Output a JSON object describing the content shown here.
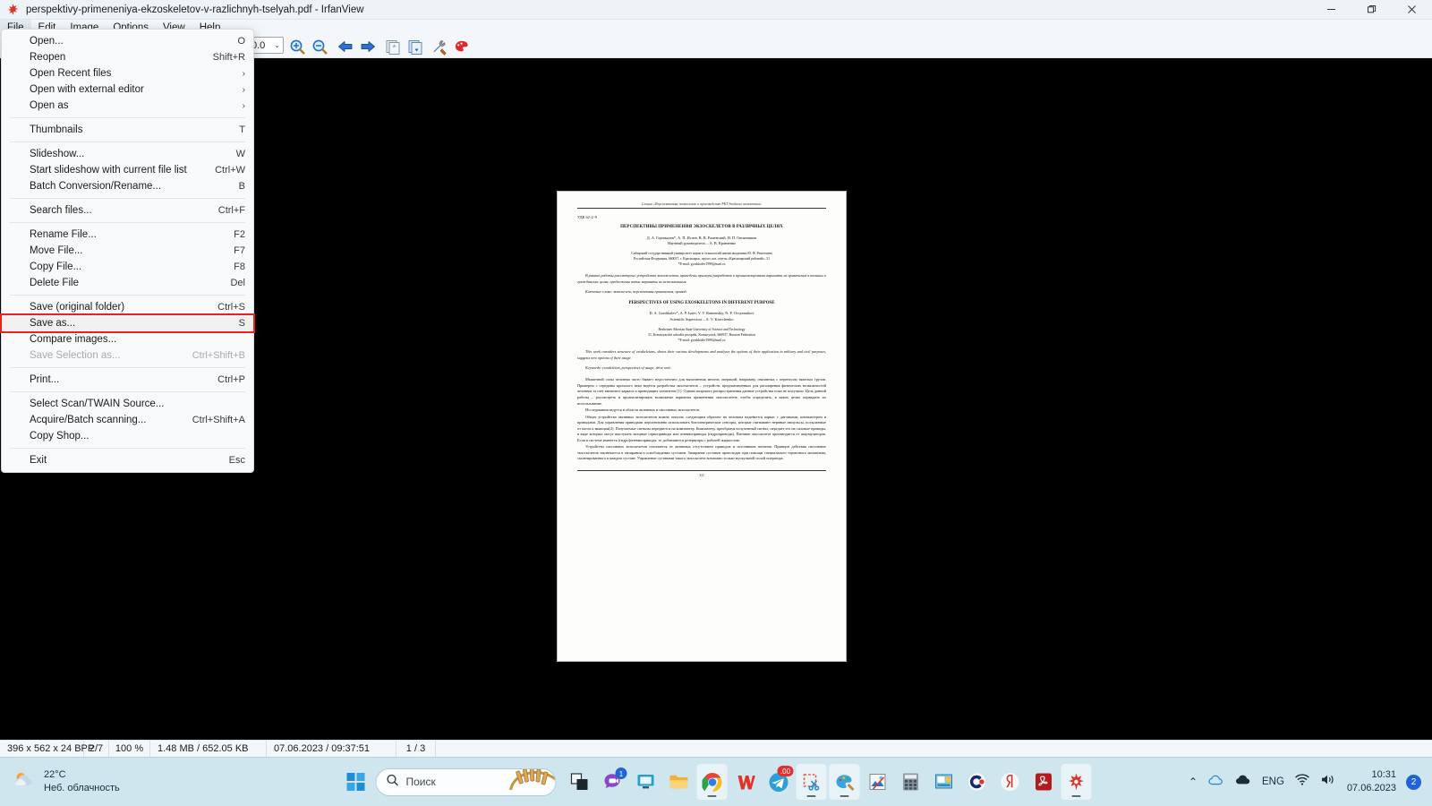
{
  "window": {
    "title": "perspektivy-primeneniya-ekzoskeletov-v-razlichnyh-tselyah.pdf - IrfanView",
    "app_icon": "irfanview-icon",
    "minimize": "–",
    "maximize": "❐",
    "close": "✕"
  },
  "menubar": {
    "items": [
      {
        "label": "File"
      },
      {
        "label": "Edit"
      },
      {
        "label": "Image"
      },
      {
        "label": "Options"
      },
      {
        "label": "View"
      },
      {
        "label": "Help"
      }
    ]
  },
  "toolbar": {
    "zoom_value": "0.0",
    "caret": "⌄",
    "buttons": [
      {
        "name": "zoom-in-icon"
      },
      {
        "name": "zoom-out-icon"
      },
      {
        "name": "previous-image-icon"
      },
      {
        "name": "next-image-icon"
      },
      {
        "name": "first-image-icon"
      },
      {
        "name": "last-image-icon"
      },
      {
        "name": "settings-icon"
      },
      {
        "name": "paint-icon"
      }
    ]
  },
  "file_menu": {
    "items": [
      {
        "label": "Open...",
        "accel": "O",
        "type": "item"
      },
      {
        "label": "Reopen",
        "accel": "Shift+R",
        "type": "item"
      },
      {
        "label": "Open Recent files",
        "accel": "›",
        "type": "submenu"
      },
      {
        "label": "Open with external editor",
        "accel": "›",
        "type": "submenu"
      },
      {
        "label": "Open as",
        "accel": "›",
        "type": "submenu"
      },
      {
        "type": "separator"
      },
      {
        "label": "Thumbnails",
        "accel": "T",
        "type": "item"
      },
      {
        "type": "separator"
      },
      {
        "label": "Slideshow...",
        "accel": "W",
        "type": "item"
      },
      {
        "label": "Start slideshow with current file list",
        "accel": "Ctrl+W",
        "type": "item"
      },
      {
        "label": "Batch Conversion/Rename...",
        "accel": "B",
        "type": "item"
      },
      {
        "type": "separator"
      },
      {
        "label": "Search files...",
        "accel": "Ctrl+F",
        "type": "item"
      },
      {
        "type": "separator"
      },
      {
        "label": "Rename File...",
        "accel": "F2",
        "type": "item"
      },
      {
        "label": "Move File...",
        "accel": "F7",
        "type": "item"
      },
      {
        "label": "Copy File...",
        "accel": "F8",
        "type": "item"
      },
      {
        "label": "Delete File",
        "accel": "Del",
        "type": "item"
      },
      {
        "type": "separator"
      },
      {
        "label": "Save (original folder)",
        "accel": "Ctrl+S",
        "type": "item"
      },
      {
        "label": "Save as...",
        "accel": "S",
        "type": "highlight"
      },
      {
        "label": "Compare images...",
        "accel": "",
        "type": "item"
      },
      {
        "label": "Save Selection as...",
        "accel": "Ctrl+Shift+B",
        "type": "disabled"
      },
      {
        "type": "separator"
      },
      {
        "label": "Print...",
        "accel": "Ctrl+P",
        "type": "item"
      },
      {
        "type": "separator"
      },
      {
        "label": "Select Scan/TWAIN Source...",
        "accel": "",
        "type": "item"
      },
      {
        "label": "Acquire/Batch scanning...",
        "accel": "Ctrl+Shift+A",
        "type": "item"
      },
      {
        "label": "Copy Shop...",
        "accel": "",
        "type": "item"
      },
      {
        "type": "separator"
      },
      {
        "label": "Exit",
        "accel": "Esc",
        "type": "item"
      }
    ],
    "highlight_color": "#e8221c"
  },
  "document": {
    "running_header": "Секция «Перспективные технологии и производство РКТ двойного назначения»",
    "udk": "УДК 62-1/-9",
    "title_ru": "ПЕРСПЕКТИВЫ ПРИМЕНЕНИЯ ЭКЗОСКЕЛЕТОВ В РАЗЛИЧНЫХ ЦЕЛЯХ",
    "authors_ru": "Д. А. Горшкалев*, А. П. Исаев, В. В. Раменский, Н. П. Овсянников",
    "supervisor_ru": "Научный руководитель – А. В. Кравченко",
    "affiliation_ru_1": "Сибирский государственный университет науки и технологий имени академика М. Ф. Решетнева",
    "affiliation_ru_2": "Российская Федерация, 660037, г. Красноярск, просп. им. газеты «Красноярский рабочий», 31",
    "email_ru": "*E-mail: gorshkalev1999@mail.ru",
    "abstract_ru": "В рамках работы рассмотрено устройство экзоскелетов, приведены примеры разработок и проанализированы варианты их применения в военных и гражданских целях, предложены новые варианты их использования.",
    "keywords_ru": "Ключевые слова: экзоскелет, перспективы применения, привод.",
    "title_en": "PERSPECTIVES OF USING EXOSKELETONS IN DIFFERENT PURPOSE",
    "authors_en": "D. A. Gorshkalev*, A. P. Isaev, V. V. Ramenskiy, N. P. Ovsyannikov",
    "supervisor_en": "Scientific Supervisor – A. V. Kravchenko",
    "affiliation_en_1": "Reshetnev Siberian State University of Science and Technology",
    "affiliation_en_2": "31, Krasnoyarskii rabochii prospekt, Krasnoyarsk, 660037, Russian Federation",
    "email_en": "*E-mail: gorshkalev1999@mail.ru",
    "abstract_en": "This work considers structure of exoskeletons, shows their various developments and analyzes the options of their application in military and civil purposes, suggests new options of their usage.",
    "keywords_en": "Keywords: exoskeleton, perspectives of usage, drive unit.",
    "body_p1": "Мышечной силы человека часто бывает недостаточно для выполнения многих операций, например, связанных с переносом тяжелых грузов. Примерно с середины прошлого века ведётся разработка экзоскелетов – устройств, предназначенных для расширения физических возможностей человека за счёт внешнего каркаса и приводящих элементов [1]. Однако широкого распространения данные устройства пока не получили. Цель данной работы – рассмотреть и проанализировать возможные варианты применения экзоскелетов, чтобы определить, в каких целях оправдано их использование.",
    "body_p2": "Исследования ведутся в области активных и пассивных экзоскелетов.",
    "body_p3": "Общее устройство активных экзоскелетов можно описать следующим образом: на человека надевается каркас с датчиками, компьютером и приводами. Для управления приводами перспективно использовать биоэлектрические сенсоры, которые считывают нервные импульсы, посылаемые от мозга к мышцам[2]. Получаемые сигналы передаются на компьютер. Компьютер, преобразуя полученный сигнал, передает его на силовые приводы, в виде которых могут выступать мощные сервоприводы или пневмоприводы (гидроприводы). Питание экзоскелета производится от аккумуляторов. Если в системе имеются (гидро)пневмоприводы, то добавляются резервуары с рабочей жидкостью.",
    "body_p4": "Устройство пассивных экзоскелетов отличается от активных отсутствием приводов и источников питания. Принцип действия пассивных экзоскелетов заключается в запирании и освобождении суставов. Запирание суставов происходит при помощи специального тормозного механизма, смонтированного в каждом суставе. Управление суставами такого экзоскелета возможно только мускульной силой оператора.",
    "page_number": "111"
  },
  "statusbar": {
    "cells": [
      "396 x 562 x 24 BPP",
      "2/7",
      "100 %",
      "1.48 MB / 652.05 KB",
      "07.06.2023 / 09:37:51",
      "1 / 3"
    ]
  },
  "taskbar": {
    "weather_temp": "22°C",
    "weather_desc": "Неб. облачность",
    "weather_icon": "partly-cloudy-icon",
    "start_icon": "windows-start-icon",
    "search_placeholder": "Поиск",
    "search_icon": "search-icon",
    "apps": [
      {
        "name": "task-view-icon",
        "running": false
      },
      {
        "name": "chat-teams-icon",
        "badge": "1",
        "running": false
      },
      {
        "name": "remote-desktop-icon",
        "running": false
      },
      {
        "name": "file-explorer-icon",
        "running": false
      },
      {
        "name": "google-chrome-icon",
        "running": true
      },
      {
        "name": "wps-office-icon",
        "running": false
      },
      {
        "name": "telegram-icon",
        "badge": ".00",
        "running": false
      },
      {
        "name": "snipping-tool-icon",
        "running": true
      },
      {
        "name": "paint-icon",
        "running": true
      },
      {
        "name": "photo-editor-icon",
        "running": false
      },
      {
        "name": "calculator-icon",
        "running": false
      },
      {
        "name": "presentation-icon",
        "running": false
      },
      {
        "name": "c-app-icon",
        "running": false
      },
      {
        "name": "yandex-browser-icon",
        "running": false
      },
      {
        "name": "adobe-acrobat-icon",
        "running": false
      },
      {
        "name": "irfanview-icon",
        "running": true
      }
    ],
    "tray": {
      "chevron": "⌃",
      "icons": [
        {
          "name": "onedrive-icon"
        },
        {
          "name": "cloud-icon"
        },
        {
          "name": "language-indicator",
          "label": "ENG"
        },
        {
          "name": "wifi-icon"
        },
        {
          "name": "volume-icon"
        }
      ],
      "clock_time": "10:31",
      "clock_date": "07.06.2023",
      "notification_count": "2"
    }
  }
}
